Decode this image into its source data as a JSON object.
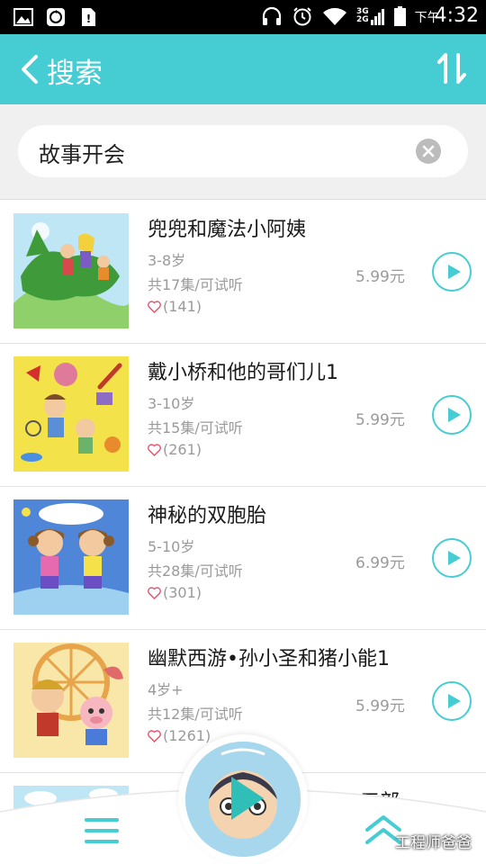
{
  "status_bar": {
    "period": "下午",
    "time": "4:32",
    "network_labels": [
      "3G",
      "2G"
    ]
  },
  "header": {
    "title": "搜索",
    "back_icon": "back-icon",
    "sort_icon": "sort-icon"
  },
  "search": {
    "query": "故事开会",
    "clear_icon": "clear-icon"
  },
  "results": [
    {
      "title": "兜兜和魔法小阿姨",
      "age": "3-8岁",
      "episodes": "共17集/可试听",
      "likes": "(141)",
      "price": "5.99元"
    },
    {
      "title": "戴小桥和他的哥们儿1",
      "age": "3-10岁",
      "episodes": "共15集/可试听",
      "likes": "(261)",
      "price": "5.99元"
    },
    {
      "title": "神秘的双胞胎",
      "age": "5-10岁",
      "episodes": "共28集/可试听",
      "likes": "(301)",
      "price": "6.99元"
    },
    {
      "title": "幽默西游•孙小圣和猪小能1",
      "age": "4岁+",
      "episodes": "共12集/可试听",
      "likes": "(1261)",
      "price": "5.99元"
    }
  ],
  "partial_item": {
    "title_fragment": "三部"
  },
  "bottom_bar": {
    "menu_icon": "menu-icon",
    "player_icon": "play-icon",
    "expand_icon": "chevron-up-icon"
  },
  "watermark": "工程师爸爸",
  "colors": {
    "accent": "#45cdd3",
    "heart": "#e8506a",
    "muted_text": "#9a9a9a"
  }
}
